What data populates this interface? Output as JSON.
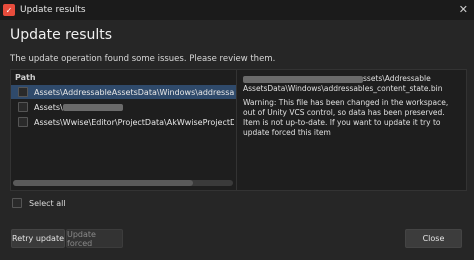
{
  "window": {
    "title": "Update results",
    "close_glyph": "✕"
  },
  "heading": "Update results",
  "subtitle": "The update operation found some issues. Please review them.",
  "list": {
    "column_header": "Path",
    "rows": [
      {
        "path": "Assets\\AddressableAssetsData\\Windows\\addressables_conten",
        "selected": true
      },
      {
        "path": "Assets\\",
        "selected": false
      },
      {
        "path": "Assets\\Wwise\\Editor\\ProjectData\\AkWwiseProjectData.asset",
        "selected": false
      }
    ]
  },
  "detail": {
    "path_tail": "ssets\\Addressable",
    "path_line2": "AssetsData\\Windows\\addressables_content_state.bin",
    "message": "Warning: This file has been changed in the workspace, out of Unity VCS control, so data has been preserved. Item is not up-to-date. If you want to update it try to update forced this item"
  },
  "select_all_label": "Select all",
  "buttons": {
    "retry": "Retry update",
    "forced": "Update forced",
    "close": "Close"
  },
  "icons": {
    "app": "unity-vcs-icon",
    "close": "close-icon"
  }
}
